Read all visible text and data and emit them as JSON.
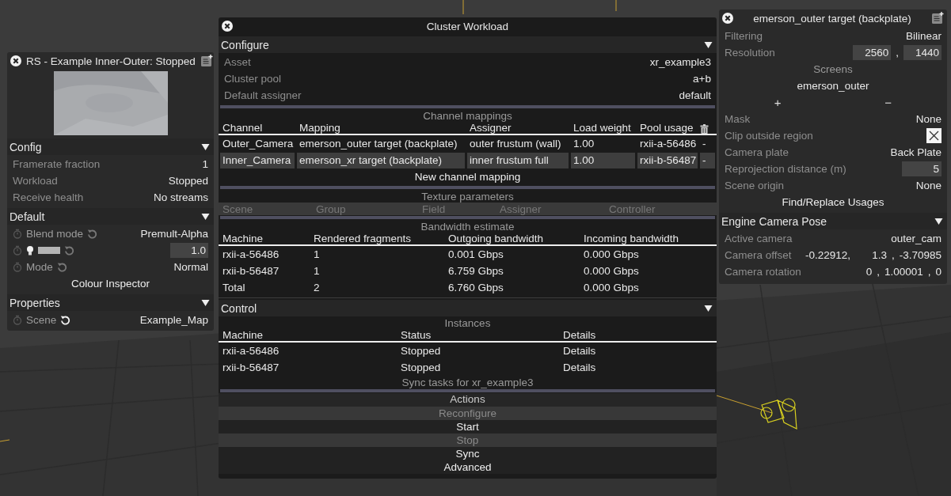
{
  "inspector": {
    "title": "RS - Example Inner-Outer: Stopped",
    "sections": [
      {
        "title": "Config",
        "expanded": true,
        "rows": [
          {
            "kind": "prop",
            "label": "Framerate fraction",
            "value": "1"
          },
          {
            "kind": "prop",
            "label": "Workload",
            "value": "Stopped"
          },
          {
            "kind": "prop",
            "label": "Receive health",
            "value": "No streams"
          }
        ]
      },
      {
        "title": "Default",
        "expanded": true,
        "rows": [
          {
            "kind": "anim",
            "label": "Blend mode",
            "value": "Premult-Alpha",
            "reset_enabled": false
          },
          {
            "kind": "intensity",
            "value": "1.0",
            "reset_enabled": false
          },
          {
            "kind": "anim",
            "label": "Mode",
            "value": "Normal",
            "reset_enabled": false
          },
          {
            "kind": "action",
            "label": "Colour Inspector"
          }
        ]
      },
      {
        "title": "Properties",
        "expanded": true,
        "rows": [
          {
            "kind": "anim",
            "label": "Scene",
            "value": "Example_Map",
            "reset_enabled": true
          }
        ]
      }
    ]
  },
  "workload": {
    "title": "Cluster Workload",
    "configure": {
      "title": "Configure",
      "expanded": true,
      "rows": [
        {
          "kind": "prop",
          "label": "Asset",
          "value": "xr_example3"
        },
        {
          "kind": "prop",
          "label": "Cluster pool",
          "value": "a+b"
        },
        {
          "kind": "prop",
          "label": "Default assigner",
          "value": "default"
        }
      ]
    },
    "channel_mappings": {
      "title": "Channel mappings",
      "columns": [
        "Channel",
        "Mapping",
        "Assigner",
        "Load weight",
        "Pool usage"
      ],
      "rows": [
        {
          "selected": false,
          "cells": [
            "Outer_Camera",
            "emerson_outer target (backplate)",
            "outer frustum (wall)",
            "1.00",
            "rxii-a-56486",
            "-"
          ]
        },
        {
          "selected": true,
          "cells": [
            "Inner_Camera",
            "emerson_xr target (backplate)",
            "inner frustum full",
            "1.00",
            "rxii-b-56487",
            "-"
          ]
        }
      ]
    },
    "new_channel_mapping": "New channel mapping",
    "texture_parameters": {
      "title": "Texture parameters",
      "columns": [
        "Scene",
        "Group",
        "Field",
        "Assigner",
        "Controller"
      ]
    },
    "bandwidth_estimate": {
      "title": "Bandwidth estimate",
      "columns": [
        "Machine",
        "Rendered fragments",
        "Outgoing bandwidth",
        "Incoming bandwidth"
      ],
      "rows": [
        {
          "cells": [
            "rxii-a-56486",
            "1",
            "0.001 Gbps",
            "0.000 Gbps"
          ]
        },
        {
          "cells": [
            "rxii-b-56487",
            "1",
            "6.759 Gbps",
            "0.000 Gbps"
          ]
        },
        {
          "cells": [
            "Total",
            "2",
            "6.760 Gbps",
            "0.000 Gbps"
          ]
        }
      ]
    },
    "control": {
      "title": "Control",
      "expanded": true,
      "instances": {
        "title": "Instances",
        "columns": [
          "Machine",
          "Status",
          "Details"
        ],
        "rows": [
          {
            "cells": [
              "rxii-a-56486",
              "Stopped",
              "Details"
            ]
          },
          {
            "cells": [
              "rxii-b-56487",
              "Stopped",
              "Details"
            ]
          }
        ]
      },
      "sync_tasks": "Sync tasks for xr_example3",
      "actions": {
        "title": "Actions",
        "buttons": [
          {
            "label": "Reconfigure",
            "disabled": true
          },
          {
            "label": "Start",
            "disabled": false
          },
          {
            "label": "Stop",
            "disabled": true
          },
          {
            "label": "Sync",
            "disabled": false
          },
          {
            "label": "Advanced",
            "disabled": false
          }
        ]
      }
    }
  },
  "target": {
    "title": "emerson_outer target (backplate)",
    "rows": [
      {
        "kind": "prop",
        "label": "Filtering",
        "value": "Bilinear"
      },
      {
        "kind": "parts",
        "label": "Resolution",
        "parts": [
          {
            "text": "2560",
            "boxed": true
          },
          {
            "text": ",",
            "boxed": false
          },
          {
            "text": "1440",
            "boxed": true
          }
        ]
      },
      {
        "kind": "heading",
        "label": "Screens"
      },
      {
        "kind": "item",
        "label": "emerson_outer"
      },
      {
        "kind": "addremove",
        "add": "+",
        "remove": "−"
      },
      {
        "kind": "prop",
        "label": "Mask",
        "value": "None"
      },
      {
        "kind": "checkbox",
        "label": "Clip outside region",
        "checked": true
      },
      {
        "kind": "prop",
        "label": "Camera plate",
        "value": "Back Plate"
      },
      {
        "kind": "parts",
        "label": "Reprojection distance (m)",
        "parts": [
          {
            "text": "5",
            "boxed": true
          }
        ]
      },
      {
        "kind": "prop",
        "label": "Scene origin",
        "value": "None"
      },
      {
        "kind": "action",
        "label": "Find/Replace Usages"
      }
    ]
  },
  "camera_pose": {
    "title": "Engine Camera Pose",
    "expanded": true,
    "rows": [
      {
        "kind": "prop",
        "label": "Active camera",
        "value": "outer_cam"
      },
      {
        "kind": "parts",
        "label": "Camera offset",
        "parts": [
          {
            "text": "-0.22912,",
            "boxed": false
          },
          {
            "text": "1.3",
            "boxed": false
          },
          {
            "text": ",",
            "boxed": false
          },
          {
            "text": "-3.70985",
            "boxed": false
          }
        ]
      },
      {
        "kind": "parts",
        "label": "Camera rotation",
        "parts": [
          {
            "text": "0",
            "boxed": false
          },
          {
            "text": ",",
            "boxed": false
          },
          {
            "text": "1.00001",
            "boxed": false
          },
          {
            "text": ",",
            "boxed": false
          },
          {
            "text": "0",
            "boxed": false
          }
        ]
      }
    ]
  }
}
